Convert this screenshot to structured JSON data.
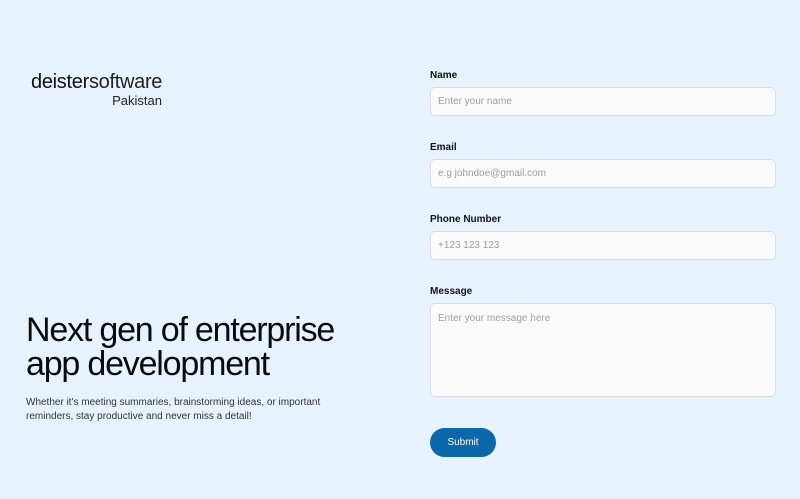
{
  "brand": {
    "name_bold": "deister",
    "name_light": "software",
    "region": "Pakistan"
  },
  "hero": {
    "headline": "Next gen of enterprise app development",
    "tagline": "Whether it's meeting summaries, brainstorming ideas, or important reminders, stay productive and never miss a detail!"
  },
  "form": {
    "name": {
      "label": "Name",
      "placeholder": "Enter your name"
    },
    "email": {
      "label": "Email",
      "placeholder": "e.g johndoe@gmail.com"
    },
    "phone": {
      "label": "Phone Number",
      "placeholder": "+123 123 123"
    },
    "message": {
      "label": "Message",
      "placeholder": "Enter your message here"
    },
    "submit_label": "Submit"
  },
  "colors": {
    "background": "#e7f3fc",
    "accent": "#0b68aa",
    "field_background": "#fafafa"
  }
}
